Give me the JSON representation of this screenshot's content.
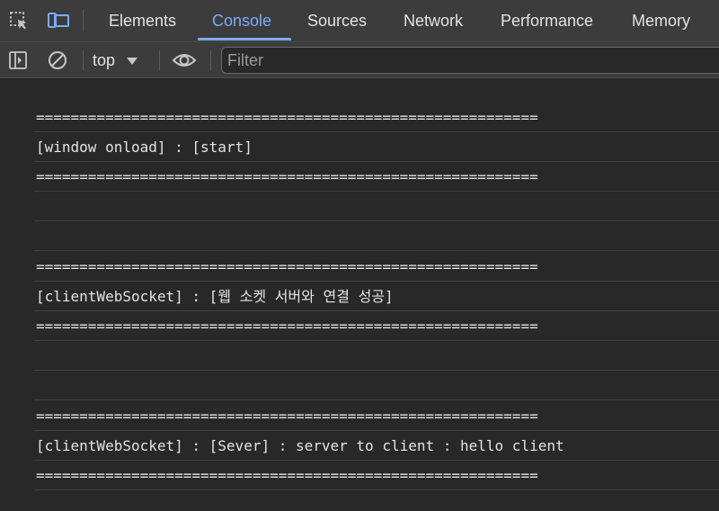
{
  "tabs": {
    "items": [
      {
        "label": "Elements"
      },
      {
        "label": "Console"
      },
      {
        "label": "Sources"
      },
      {
        "label": "Network"
      },
      {
        "label": "Performance"
      },
      {
        "label": "Memory"
      }
    ],
    "active": "Console"
  },
  "toolbar": {
    "context": "top",
    "filter_placeholder": "Filter"
  },
  "icons": {
    "inspect": "inspect-element-icon",
    "device": "device-toolbar-icon",
    "sidebar": "sidebar-toggle-icon",
    "clear": "clear-console-icon",
    "dropdown": "dropdown-arrow-icon",
    "eye": "live-expression-eye-icon"
  },
  "colors": {
    "accent": "#7cacf8",
    "background": "#282828",
    "panel": "#3c3c3c",
    "text": "#e3e3e3"
  },
  "console": {
    "messages": [
      "==========================================================",
      "[window onload] : [start]",
      "==========================================================",
      "",
      "",
      "==========================================================",
      "[clientWebSocket] : [웹 소켓 서버와 연결 성공]",
      "==========================================================",
      "",
      "",
      "==========================================================",
      "[clientWebSocket] : [Sever] : server to client : hello client",
      "=========================================================="
    ]
  }
}
